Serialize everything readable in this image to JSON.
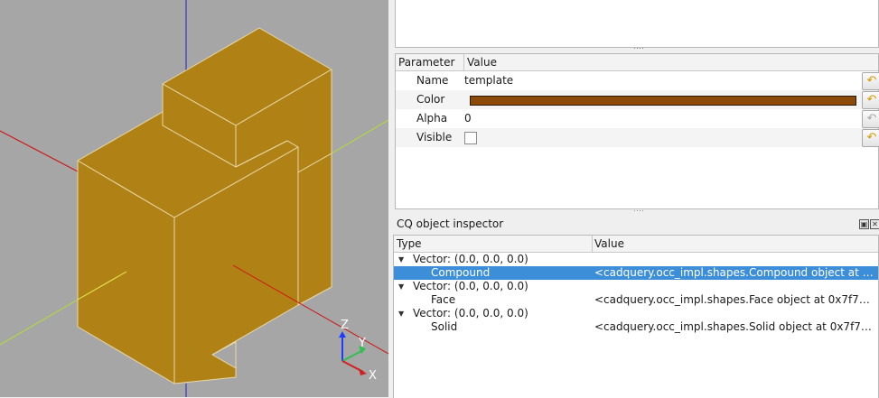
{
  "viewport": {
    "model_color": "#b08216",
    "axis_labels": {
      "z": "Z",
      "y": "Y",
      "x": "X"
    }
  },
  "parameters": {
    "headers": {
      "parameter": "Parameter",
      "value": "Value"
    },
    "rows": [
      {
        "name": "Name",
        "value": "template",
        "revert_enabled": true
      },
      {
        "name": "Color",
        "value": "#8b4a0a",
        "revert_enabled": true
      },
      {
        "name": "Alpha",
        "value": "0",
        "revert_enabled": false
      },
      {
        "name": "Visible",
        "checked": false,
        "revert_enabled": true
      }
    ]
  },
  "inspector": {
    "title": "CQ object inspector",
    "headers": {
      "type": "Type",
      "value": "Value"
    },
    "items": [
      {
        "label": "Vector: (0.0, 0.0, 0.0)",
        "value": ""
      },
      {
        "label": "Compound",
        "value": "<cadquery.occ_impl.shapes.Compound object at 0x7f7…"
      },
      {
        "label": "Vector: (0.0, 0.0, 0.0)",
        "value": ""
      },
      {
        "label": "Face",
        "value": "<cadquery.occ_impl.shapes.Face object at 0x7f7…"
      },
      {
        "label": "Vector: (0.0, 0.0, 0.0)",
        "value": ""
      },
      {
        "label": "Solid",
        "value": "<cadquery.occ_impl.shapes.Solid object at 0x7f7…"
      }
    ]
  }
}
